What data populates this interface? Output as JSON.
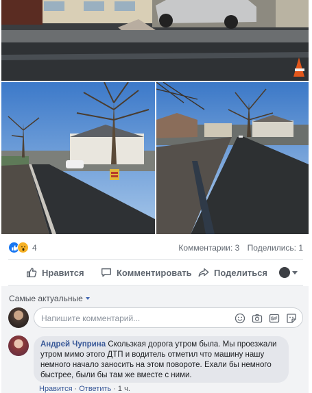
{
  "reactions": {
    "count": "4",
    "icons": [
      "like-icon",
      "wow-icon"
    ]
  },
  "stats": {
    "comments": "Комментарии: 3",
    "shares": "Поделились: 1"
  },
  "actions": {
    "like": "Нравится",
    "comment": "Комментировать",
    "share": "Поделиться"
  },
  "comments": {
    "sort_label": "Самые актуальные",
    "input_placeholder": "Напишите комментарий...",
    "input_icons": [
      "emoji-icon",
      "camera-icon",
      "gif-icon",
      "sticker-icon"
    ],
    "items": [
      {
        "author": "Андрей Чуприна",
        "text": "Скользкая дорога утром была. Мы проезжали утром мимо этого ДТП и водитель отметил что машину нашу немного начало заносить на этом повороте. Ехали бы немного быстрее, были бы там же вместе с ними.",
        "like_label": "Нравится",
        "reply_label": "Ответить",
        "time": "1 ч."
      }
    ]
  },
  "colors": {
    "accent": "#1877f2",
    "link": "#385898",
    "muted_text": "#606770",
    "comment_bg": "#f2f3f5",
    "bubble_bg": "#e4e6eb"
  }
}
